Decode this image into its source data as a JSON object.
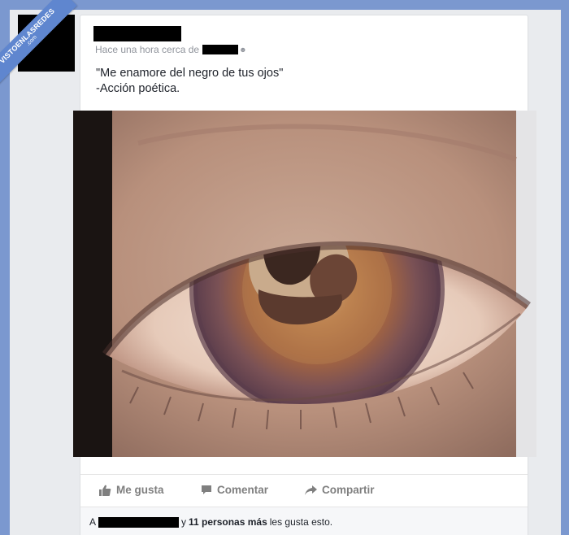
{
  "watermark": {
    "line1": "VISTOENLASREDES",
    "line2": ".com"
  },
  "post": {
    "time_prefix": "Hace una hora cerca de",
    "status_lines": [
      "\"Me enamore del negro de tus ojos\"",
      "-Acción poética."
    ]
  },
  "actions": {
    "like": "Me gusta",
    "comment": "Comentar",
    "share": "Compartir"
  },
  "likes": {
    "prefix": "A",
    "connector": "y",
    "count_text": "11 personas más",
    "suffix": "les gusta esto."
  },
  "colors": {
    "frame": "#7b98cf",
    "banner": "#5f86cf",
    "action_text": "#7f7f7f",
    "meta_text": "#90949c"
  },
  "icons": {
    "like": "thumbs-up-icon",
    "comment": "speech-bubble-icon",
    "share": "share-arrow-icon",
    "audience": "friends-icon"
  }
}
